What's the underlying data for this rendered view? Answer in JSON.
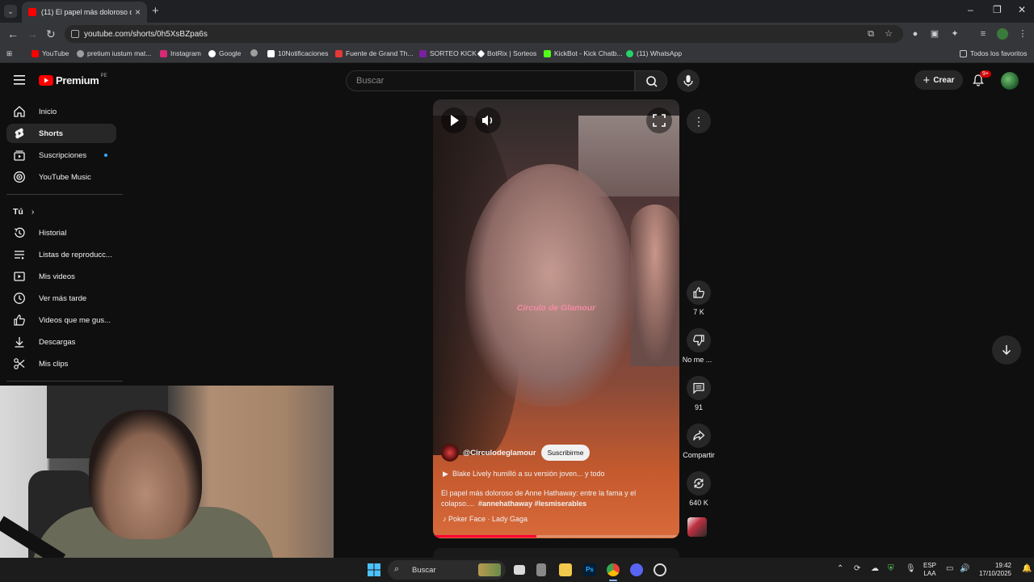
{
  "browser": {
    "tab_title": "(11) El papel más doloroso de A",
    "url": "youtube.com/shorts/0h5XsBZpa6s",
    "bookmarks": [
      {
        "label": "YouTube",
        "color": "#ff0000"
      },
      {
        "label": "pretium iustum mat...",
        "color": "#9e9e9e"
      },
      {
        "label": "Instagram",
        "color": "#d62976"
      },
      {
        "label": "Google",
        "color": "#4285f4"
      },
      {
        "label": "",
        "color": "#9e9e9e"
      },
      {
        "label": "10Notificaciones",
        "color": "#ffffff"
      },
      {
        "label": "Fuente de Grand Th...",
        "color": "#e53935"
      },
      {
        "label": "SORTEO KICK",
        "color": "#7b1fa2"
      },
      {
        "label": "BotRix | Sorteos",
        "color": "#ffffff"
      },
      {
        "label": "KickBot - Kick Chatb...",
        "color": "#53fc18"
      },
      {
        "label": "(11) WhatsApp",
        "color": "#25d366"
      }
    ],
    "all_bookmarks": "Todos los favoritos"
  },
  "youtube": {
    "logo_text": "Premium",
    "logo_region": "PE",
    "search_placeholder": "Buscar",
    "create_label": "Crear",
    "notifications_badge": "9+",
    "sidebar": {
      "main": [
        {
          "label": "Inicio",
          "icon": "home-icon"
        },
        {
          "label": "Shorts",
          "icon": "shorts-icon"
        },
        {
          "label": "Suscripciones",
          "icon": "subscriptions-icon"
        },
        {
          "label": "YouTube Music",
          "icon": "music-icon"
        }
      ],
      "you_header": "Tú",
      "you": [
        {
          "label": "Historial",
          "icon": "history-icon"
        },
        {
          "label": "Listas de reproducc...",
          "icon": "playlists-icon"
        },
        {
          "label": "Mis videos",
          "icon": "my-videos-icon"
        },
        {
          "label": "Ver más tarde",
          "icon": "watch-later-icon"
        },
        {
          "label": "Videos que me gus...",
          "icon": "liked-icon"
        },
        {
          "label": "Descargas",
          "icon": "download-icon"
        },
        {
          "label": "Mis clips",
          "icon": "clips-icon"
        }
      ]
    },
    "short": {
      "watermark": "Circulo de Glamour",
      "channel": "@Circulodeglamour",
      "subscribe_label": "Suscribirme",
      "playlist": "Blake Lively humilló a su versión joven... y todo",
      "description": "El papel más doloroso de Anne Hathaway: entre la fama y el colapso....",
      "hashtags": "#annehathaway #lesmiserables",
      "sound": "Poker Face · Lady Gaga",
      "progress": 0.42
    },
    "actions": {
      "like_count": "7 K",
      "dislike_label": "No me ...",
      "comment_count": "91",
      "share_label": "Compartir",
      "remix_count": "640 K"
    }
  },
  "taskbar": {
    "search_label": "Buscar",
    "lang_top": "ESP",
    "lang_bottom": "LAA",
    "time": "19:42",
    "date": "17/10/2025"
  }
}
